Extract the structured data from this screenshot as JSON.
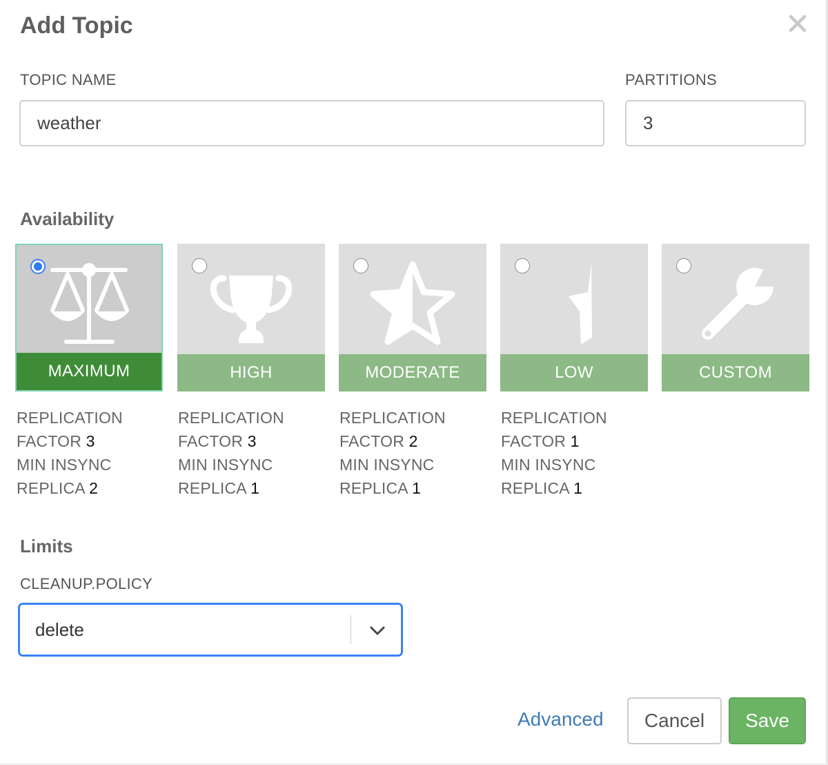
{
  "dialog": {
    "title": "Add Topic"
  },
  "topic_name": {
    "label": "TOPIC NAME",
    "value": "weather"
  },
  "partitions": {
    "label": "PARTITIONS",
    "value": "3"
  },
  "availability": {
    "title": "Availability",
    "options": [
      {
        "label": "MAXIMUM",
        "icon": "scales-icon",
        "selected": true,
        "desc": {
          "line1": "REPLICATION",
          "factor_label": "FACTOR ",
          "factor": "3",
          "line3": "MIN INSYNC",
          "replica_label": "REPLICA ",
          "replica": "2"
        }
      },
      {
        "label": "HIGH",
        "icon": "trophy-icon",
        "selected": false,
        "desc": {
          "line1": "REPLICATION",
          "factor_label": "FACTOR ",
          "factor": "3",
          "line3": "MIN INSYNC",
          "replica_label": "REPLICA ",
          "replica": "1"
        }
      },
      {
        "label": "MODERATE",
        "icon": "half-star-icon",
        "selected": false,
        "desc": {
          "line1": "REPLICATION",
          "factor_label": "FACTOR ",
          "factor": "2",
          "line3": "MIN INSYNC",
          "replica_label": "REPLICA ",
          "replica": "1"
        }
      },
      {
        "label": "LOW",
        "icon": "partial-star-icon",
        "selected": false,
        "desc": {
          "line1": "REPLICATION",
          "factor_label": "FACTOR ",
          "factor": "1",
          "line3": "MIN INSYNC",
          "replica_label": "REPLICA ",
          "replica": "1"
        }
      },
      {
        "label": "CUSTOM",
        "icon": "wrench-icon",
        "selected": false
      }
    ]
  },
  "limits": {
    "title": "Limits",
    "cleanup_policy": {
      "label": "CLEANUP.POLICY",
      "value": "delete"
    }
  },
  "footer": {
    "advanced_label": "Advanced",
    "cancel_label": "Cancel",
    "save_label": "Save"
  },
  "colors": {
    "selected_footer": "#3f8c38",
    "card_footer": "#8cb985",
    "save_button": "#6ab463",
    "focus_border": "#3b82f6",
    "link": "#3e7bb4"
  }
}
